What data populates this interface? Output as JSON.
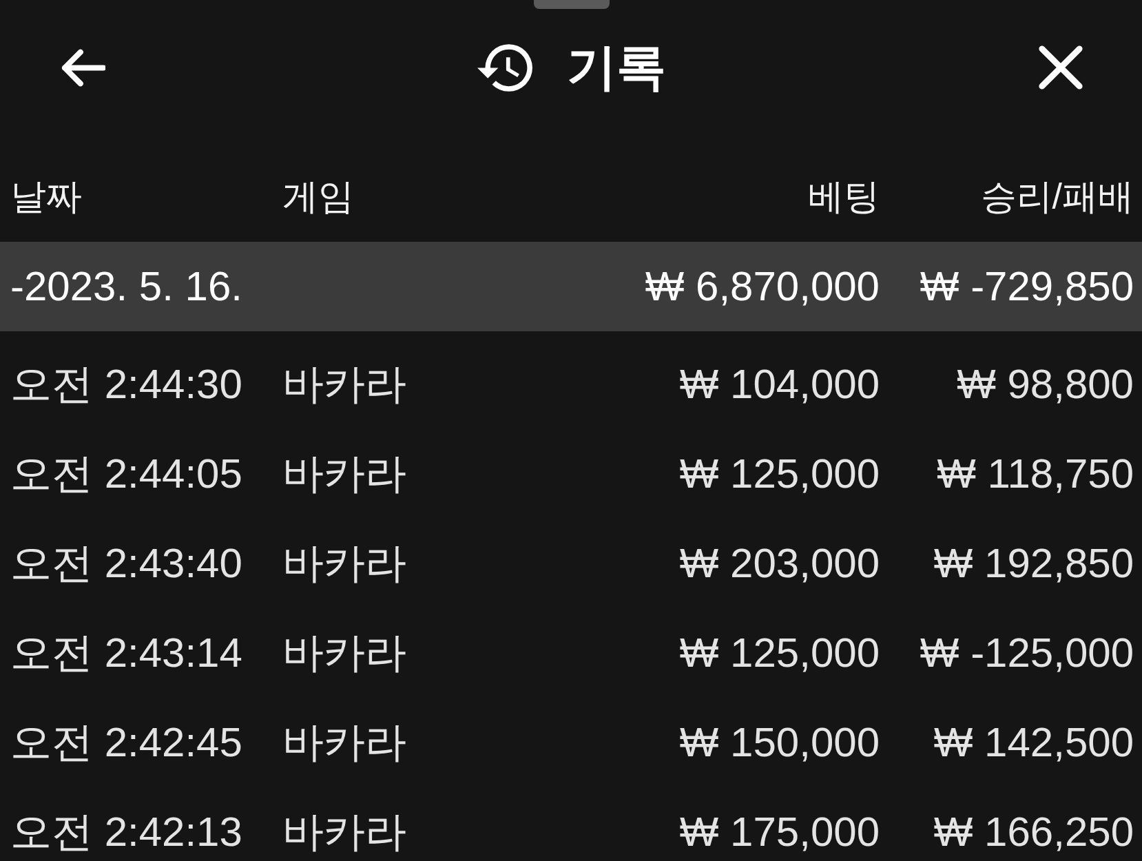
{
  "header": {
    "title": "기록"
  },
  "table": {
    "columns": [
      "날짜",
      "게임",
      "베팅",
      "승리/패배"
    ],
    "groups": [
      {
        "label": "-2023. 5. 16.",
        "bet_total": "₩ 6,870,000",
        "result_total": "₩ -729,850",
        "rows": [
          {
            "time": "오전 2:44:30",
            "game": "바카라",
            "bet": "₩ 104,000",
            "result": "₩ 98,800"
          },
          {
            "time": "오전 2:44:05",
            "game": "바카라",
            "bet": "₩ 125,000",
            "result": "₩ 118,750"
          },
          {
            "time": "오전 2:43:40",
            "game": "바카라",
            "bet": "₩ 203,000",
            "result": "₩ 192,850"
          },
          {
            "time": "오전 2:43:14",
            "game": "바카라",
            "bet": "₩ 125,000",
            "result": "₩ -125,000"
          },
          {
            "time": "오전 2:42:45",
            "game": "바카라",
            "bet": "₩ 150,000",
            "result": "₩ 142,500"
          },
          {
            "time": "오전 2:42:13",
            "game": "바카라",
            "bet": "₩ 175,000",
            "result": "₩ 166,250"
          }
        ]
      }
    ]
  }
}
